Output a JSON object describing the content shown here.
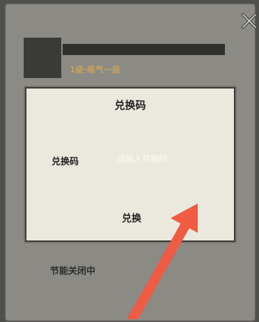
{
  "profile": {
    "level_text": "1级·练气一层"
  },
  "redeem_dialog": {
    "title": "兑换码",
    "field_label": "兑换码",
    "input_placeholder": "请输入兑换码",
    "input_value": "",
    "redeem_button_label": "兑换"
  },
  "status_text": "节能关闭中",
  "icons": {
    "close": "close-x-icon",
    "annotation_arrow": "red-arrow"
  },
  "colors": {
    "level_text": "#c9a35a",
    "panel": "#8b8a85",
    "dialog": "#ebe8de",
    "arrow": "#ef5b43"
  }
}
